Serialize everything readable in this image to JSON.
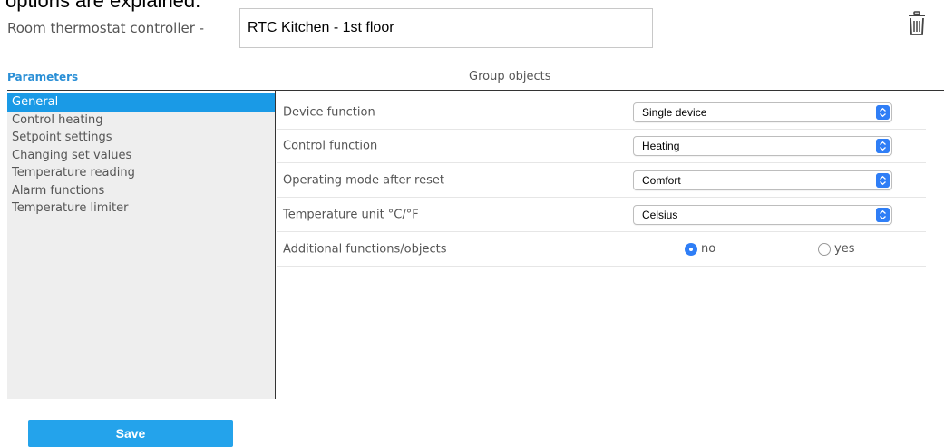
{
  "background_text": "options are explained.",
  "header": {
    "title_label": "Room thermostat controller -",
    "device_name": "RTC Kitchen - 1st floor",
    "delete_icon": "trash-icon"
  },
  "tabs": {
    "parameters": "Parameters",
    "group_objects": "Group objects"
  },
  "sidebar": {
    "items": [
      {
        "label": "General",
        "active": true
      },
      {
        "label": "Control heating",
        "active": false
      },
      {
        "label": "Setpoint settings",
        "active": false
      },
      {
        "label": "Changing set values",
        "active": false
      },
      {
        "label": "Temperature reading",
        "active": false
      },
      {
        "label": "Alarm functions",
        "active": false
      },
      {
        "label": "Temperature limiter",
        "active": false
      }
    ]
  },
  "parameters": [
    {
      "label": "Device function",
      "value": "Single device"
    },
    {
      "label": "Control function",
      "value": "Heating"
    },
    {
      "label": "Operating mode after reset",
      "value": "Comfort"
    },
    {
      "label": "Temperature unit °C/°F",
      "value": "Celsius"
    }
  ],
  "additional": {
    "label": "Additional functions/objects",
    "options": [
      "no",
      "yes"
    ],
    "selected": "no"
  },
  "footer": {
    "save_label": "Save"
  },
  "colors": {
    "accent": "#1a9ae6",
    "save": "#24a3eb",
    "select_arrow": "#2f7ef6",
    "tab_active": "#2a8fd6"
  }
}
